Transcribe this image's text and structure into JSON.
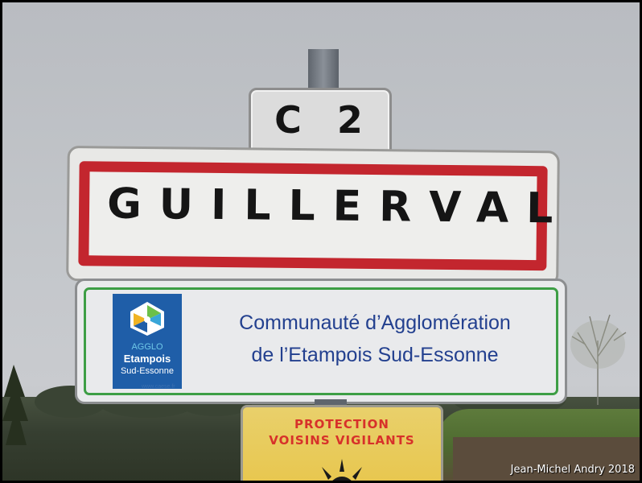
{
  "signs": {
    "route_plate": "C 2",
    "town_name": "GUILLERVAL",
    "agglomeration": {
      "line1": "Communauté d’Agglomération",
      "line2": "de l’Etampois Sud-Essonne",
      "logo": {
        "agglo": "AGGLO",
        "name": "Etampois",
        "sub": "Sud-Essonne",
        "url": "www.caese.fr"
      }
    },
    "warning": {
      "line1": "PROTECTION",
      "line2": "VOISINS VIGILANTS"
    }
  },
  "credit": "Jean-Michel Andry 2018",
  "colors": {
    "sign_red": "#c3262e",
    "agglo_text": "#23408f",
    "agglo_border": "#3d9e45",
    "warning_bg": "#e7c54a",
    "warning_text": "#d7312a"
  }
}
